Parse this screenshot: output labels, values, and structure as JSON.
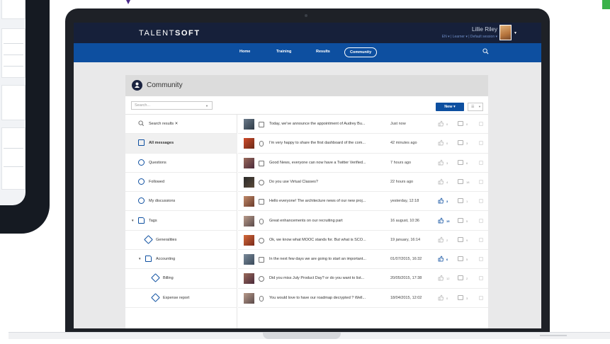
{
  "colors": {
    "topbar": "#16203a",
    "navbar": "#0d4fa0",
    "accent": "#0d4fa0",
    "panel_header": "#dcdcdc"
  },
  "header": {
    "logo_light": "TALENT",
    "logo_bold": "SOFT",
    "user_name": "Lillie Riley",
    "user_meta": "EN ▾ | Learner ▾ | Default session ▾"
  },
  "nav": {
    "items": [
      {
        "label": "Home"
      },
      {
        "label": "Training"
      },
      {
        "label": "Results"
      },
      {
        "label": "Community",
        "active": true
      }
    ],
    "search_icon": "search-icon"
  },
  "community": {
    "title": "Community",
    "icon": "people-icon",
    "search_placeholder": "Search...",
    "new_button": "New ▾",
    "view_toggle_icon": "list-view-icon"
  },
  "sidebar": {
    "items": [
      {
        "label": "Search results ✕",
        "icon": "search-icon"
      },
      {
        "label": "All messages",
        "icon": "message-icon",
        "active": true
      },
      {
        "label": "Questions",
        "icon": "question-icon"
      },
      {
        "label": "Followed",
        "icon": "followed-icon"
      },
      {
        "label": "My discussions",
        "icon": "discussion-icon"
      },
      {
        "label": "Tags",
        "icon": "folder-icon",
        "expanded": true
      },
      {
        "label": "Generalities",
        "icon": "tag-icon"
      },
      {
        "label": "Accounting",
        "icon": "folder-icon",
        "expanded": true
      },
      {
        "label": "Billing",
        "icon": "tag-icon"
      },
      {
        "label": "Expense report",
        "icon": "tag-icon"
      }
    ]
  },
  "messages": [
    {
      "type": "message",
      "title": "Today, we've announce the appointment of Audrey Bu...",
      "date": "Just now",
      "likes": "0",
      "comments": "0"
    },
    {
      "type": "file",
      "title": "I'm very happy to share the first dashboard of the com...",
      "date": "42 minutes ago",
      "likes": "0",
      "comments": "3"
    },
    {
      "type": "message",
      "title": "Good News, everyone can now have a Twitter Verified...",
      "date": "7 hours ago",
      "likes": "3",
      "comments": "6"
    },
    {
      "type": "question",
      "title": "Do you use Virtual Classes?",
      "date": "22 hours ago",
      "likes": "4",
      "comments": "18"
    },
    {
      "type": "message",
      "title": "Hello everyone! The architecture news of our new proj...",
      "date": "yesterday, 12:18",
      "likes": "3",
      "comments": "1",
      "liked": true
    },
    {
      "type": "file",
      "title": "Great enhancements on our recruiting part",
      "date": "16 august, 10:36",
      "likes": "15",
      "comments": "5",
      "liked": true
    },
    {
      "type": "question",
      "title": "Ok, we know what MOOC stands for. But what is SCO...",
      "date": "19 january, 16:14",
      "likes": "2",
      "comments": "9"
    },
    {
      "type": "message",
      "title": "In the next few days we are going to start an important...",
      "date": "01/07/2015, 16:32",
      "likes": "6",
      "comments": "5",
      "liked": true
    },
    {
      "type": "question",
      "title": "Did you miss July Product Day? or do you want to list...",
      "date": "20/05/2015, 17:38",
      "likes": "12",
      "comments": "2"
    },
    {
      "type": "file",
      "title": "You would love to have our roadmap decrypted ? Well...",
      "date": "18/04/2015, 12:02",
      "likes": "0",
      "comments": "3"
    }
  ]
}
